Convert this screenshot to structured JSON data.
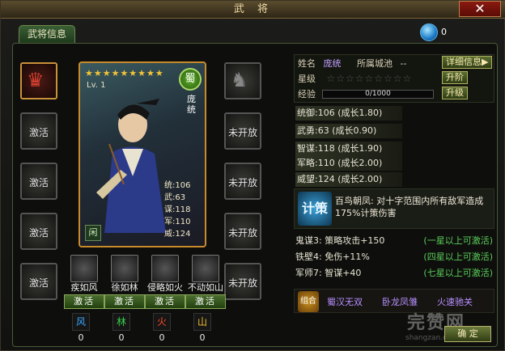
{
  "window": {
    "title": "武 将",
    "close_label": "✕"
  },
  "tabs": [
    {
      "label": "武将信息"
    }
  ],
  "currency": {
    "value": "0",
    "icon": "gem-orb-icon"
  },
  "left_slots": [
    {
      "label": "",
      "icon": "helmet-icon"
    },
    {
      "label": "激活",
      "icon": "armor-icon"
    },
    {
      "label": "激活",
      "icon": "book-icon"
    },
    {
      "label": "激活",
      "icon": "sword-icon"
    },
    {
      "label": "激活",
      "icon": "boots-icon"
    }
  ],
  "right_slots": [
    {
      "label": "",
      "icon": "horse-icon"
    },
    {
      "label": "未开放",
      "icon": "lock-icon"
    },
    {
      "label": "未开放",
      "icon": "lock-icon"
    },
    {
      "label": "未开放",
      "icon": "lock-icon"
    },
    {
      "label": "未开放",
      "icon": "lock-icon"
    }
  ],
  "card": {
    "stars": "★★★★★★★★★",
    "level": "Lv. 1",
    "faction": "蜀",
    "name": "庞统",
    "stats": [
      "统:106",
      "武:63",
      "谋:118",
      "军:110",
      "威:124"
    ],
    "idle_badge": "闲"
  },
  "skills": [
    {
      "name": "疾如风",
      "button": "激活"
    },
    {
      "name": "徐如林",
      "button": "激活"
    },
    {
      "name": "侵略如火",
      "button": "激活"
    },
    {
      "name": "不动如山",
      "button": "激活"
    }
  ],
  "elements": [
    {
      "glyph": "风",
      "value": "0",
      "color": "#3aa8ff"
    },
    {
      "glyph": "林",
      "value": "0",
      "color": "#3ad04a"
    },
    {
      "glyph": "火",
      "value": "0",
      "color": "#ff4a2a"
    },
    {
      "glyph": "山",
      "value": "0",
      "color": "#f2c030"
    }
  ],
  "info": {
    "name_label": "姓名",
    "name_value": "庞统",
    "city_label": "所属城池",
    "city_value": "--",
    "detail_button": "详细信息▶",
    "star_label": "星级",
    "star_rating": "☆☆☆☆☆☆☆☆☆",
    "upgrade_star_button": "升阶",
    "exp_label": "经验",
    "exp_value": "0/1000",
    "upgrade_button": "升级"
  },
  "stats": [
    "统御:106 (成长1.80)",
    "武勇:63 (成长0.90)",
    "智谋:118 (成长1.90)",
    "军略:110 (成长2.00)",
    "威望:124 (成长2.00)"
  ],
  "main_skill": {
    "icon_text": "计策",
    "text": "百鸟朝凤: 对十字范围内所有敌军造成175%计策伤害"
  },
  "passives": [
    {
      "left": "鬼谋3: 策略攻击+150",
      "right": "(一星以上可激活)"
    },
    {
      "left": "铁壁4: 免伤+11%",
      "right": "(四星以上可激活)"
    },
    {
      "left": "军师7: 智谋+40",
      "right": "(七星以上可激活)"
    }
  ],
  "combo": {
    "icon_text": "组合",
    "items": [
      "蜀汉无双",
      "卧龙凤雏",
      "火速驰关"
    ]
  },
  "confirm_button": "确 定",
  "watermark": {
    "main": "完赞网",
    "sub": "shangzan.com"
  }
}
